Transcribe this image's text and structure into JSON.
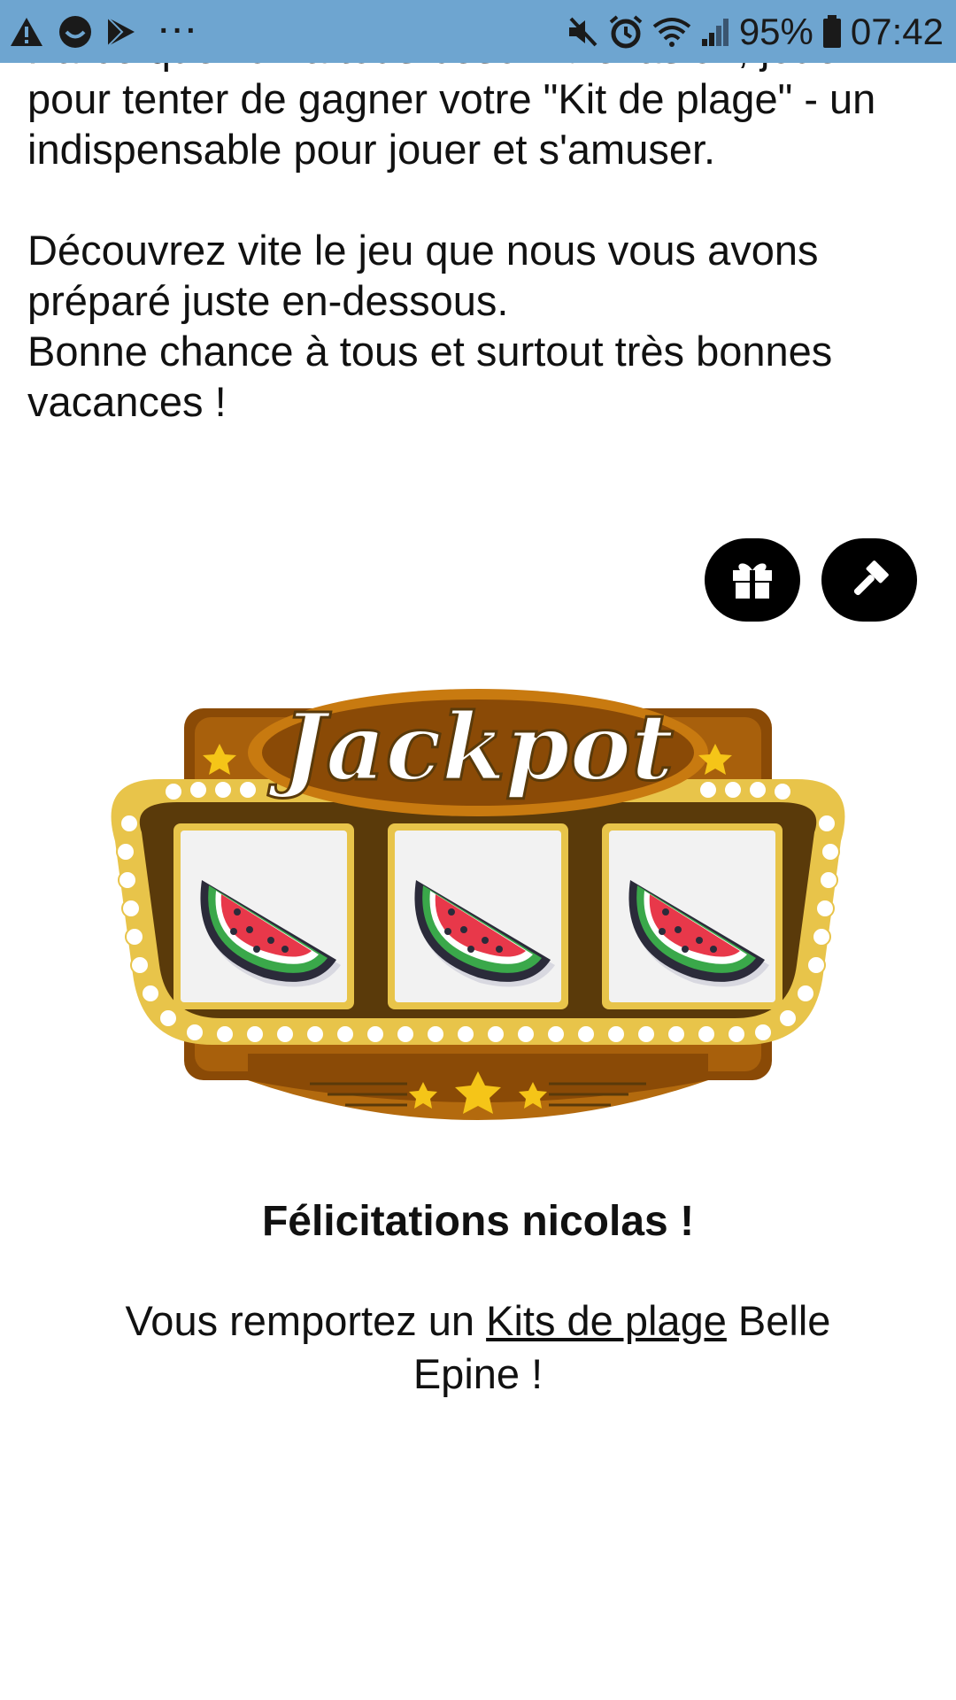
{
  "status_bar": {
    "battery": "95%",
    "time": "07:42",
    "left_icons": [
      "warning-icon",
      "smiley-app-icon",
      "play-store-icon",
      "more-dots-icon"
    ],
    "right_icons": [
      "mute-icon",
      "alarm-icon",
      "wifi-icon",
      "signal-icon",
      "battery-icon"
    ],
    "dots": "···"
  },
  "intro": {
    "line_partial": "Parce que l'on a tous besoin d'évasion, jouez",
    "line1": "pour tenter de gagner votre \"Kit de plage\" - un",
    "line2": "indispensable pour jouer et s'amuser.",
    "line3": "Découvrez vite le jeu que nous vous avons",
    "line4": "préparé juste en-dessous.",
    "line5": "Bonne chance à tous et surtout très bonnes",
    "line6": "vacances !"
  },
  "actions": {
    "gift_icon": "gift-icon",
    "gavel_icon": "gavel-icon"
  },
  "jackpot": {
    "title": "Jackpot",
    "reels": [
      "watermelon",
      "watermelon",
      "watermelon"
    ]
  },
  "result": {
    "congrats": "Félicitations nicolas !",
    "prefix": "Vous remportez un ",
    "prize_link": "Kits de plage",
    "suffix": " Belle Epine !"
  },
  "colors": {
    "status_bar": "#6ea5d0",
    "machine_brown": "#5a3a0a",
    "machine_gold": "#e8c44a",
    "machine_orange": "#c87a10"
  }
}
